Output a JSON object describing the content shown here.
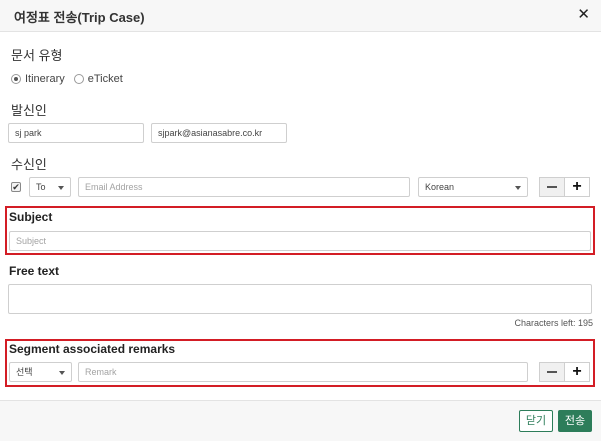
{
  "dialog": {
    "title": "여정표 전송(Trip Case)",
    "close_symbol": "✕"
  },
  "document_type": {
    "label": "문서 유형",
    "options": [
      {
        "label": "Itinerary",
        "selected": true
      },
      {
        "label": "eTicket",
        "selected": false
      }
    ]
  },
  "sender": {
    "label": "발신인",
    "name_value": "sj park",
    "email_value": "sjpark@asianasabre.co.kr"
  },
  "recipient": {
    "label": "수신인",
    "checked": true,
    "check_symbol": "✔",
    "type_selected": "To",
    "email_placeholder": "Email Address",
    "language_selected": "Korean"
  },
  "subject": {
    "label": "Subject",
    "placeholder": "Subject"
  },
  "free_text": {
    "label": "Free text",
    "chars_left": "Characters left: 195"
  },
  "segment_remarks": {
    "label": "Segment associated remarks",
    "select_value": "선택",
    "remark_placeholder": "Remark"
  },
  "footer": {
    "close_label": "닫기",
    "send_label": "전송"
  },
  "colors": {
    "accent": "#2d7d5a",
    "highlight_border": "#d31d25"
  }
}
